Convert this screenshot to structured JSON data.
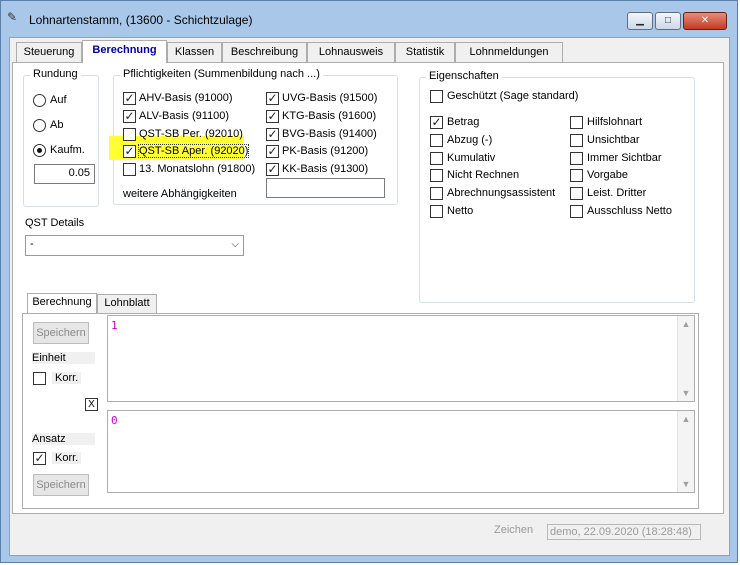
{
  "window": {
    "title": "Lohnartenstamm, (13600 - Schichtzulage)",
    "controls": {
      "minimize": "▁",
      "maximize": "□",
      "close": "✕"
    }
  },
  "tabs": [
    "Steuerung",
    "Berechnung",
    "Klassen",
    "Beschreibung",
    "Lohnausweis",
    "Statistik",
    "Lohnmeldungen"
  ],
  "rundung": {
    "title": "Rundung",
    "options": [
      "Auf",
      "Ab",
      "Kaufm."
    ],
    "selected": "Kaufm.",
    "value": "0.05"
  },
  "pflicht": {
    "title": "Pflichtigkeiten (Summenbildung nach  ...)",
    "left": [
      {
        "label": "AHV-Basis (91000)",
        "checked": true
      },
      {
        "label": "ALV-Basis (91100)",
        "checked": true
      },
      {
        "label": "QST-SB Per. (92010)",
        "checked": false
      },
      {
        "label": "QST-SB Aper. (92020)",
        "checked": true
      },
      {
        "label": "13. Monatslohn (91800)",
        "checked": false
      }
    ],
    "right": [
      {
        "label": "UVG-Basis (91500)",
        "checked": true
      },
      {
        "label": "KTG-Basis (91600)",
        "checked": true
      },
      {
        "label": "BVG-Basis (91400)",
        "checked": true
      },
      {
        "label": "PK-Basis (91200)",
        "checked": true
      },
      {
        "label": "KK-Basis (91300)",
        "checked": true
      }
    ],
    "weitere_label": "weitere Abhängigkeiten",
    "weitere_value": ""
  },
  "qst": {
    "label": "QST Details",
    "value": "-"
  },
  "eigenschaften": {
    "title": "Eigenschaften",
    "geschuetzt": {
      "label": "Geschützt (Sage standard)",
      "checked": false
    },
    "left": [
      {
        "label": "Betrag",
        "checked": true
      },
      {
        "label": "Abzug (-)",
        "checked": false
      },
      {
        "label": "Kumulativ",
        "checked": false
      },
      {
        "label": "Nicht Rechnen",
        "checked": false
      },
      {
        "label": "Abrechnungsassistent",
        "checked": false
      },
      {
        "label": "Netto",
        "checked": false
      }
    ],
    "right": [
      {
        "label": "Hilfslohnart",
        "checked": false
      },
      {
        "label": "Unsichtbar",
        "checked": false
      },
      {
        "label": "Immer Sichtbar",
        "checked": false
      },
      {
        "label": "Vorgabe",
        "checked": false
      },
      {
        "label": "Leist. Dritter",
        "checked": false
      },
      {
        "label": "Ausschluss Netto",
        "checked": false
      }
    ]
  },
  "lower": {
    "tabs": [
      "Berechnung",
      "Lohnblatt"
    ],
    "speichern1": "Speichern",
    "einheit": "Einheit",
    "einheit_korr": {
      "label": "Korr.",
      "checked": false
    },
    "x_button": "X",
    "ansatz": "Ansatz",
    "ansatz_korr": {
      "label": "Korr.",
      "checked": true
    },
    "speichern2": "Speichern",
    "formula1": "1",
    "formula2": "0"
  },
  "status": {
    "label": "Zeichen",
    "value": "demo, 22.09.2020 (18:28:48)"
  }
}
